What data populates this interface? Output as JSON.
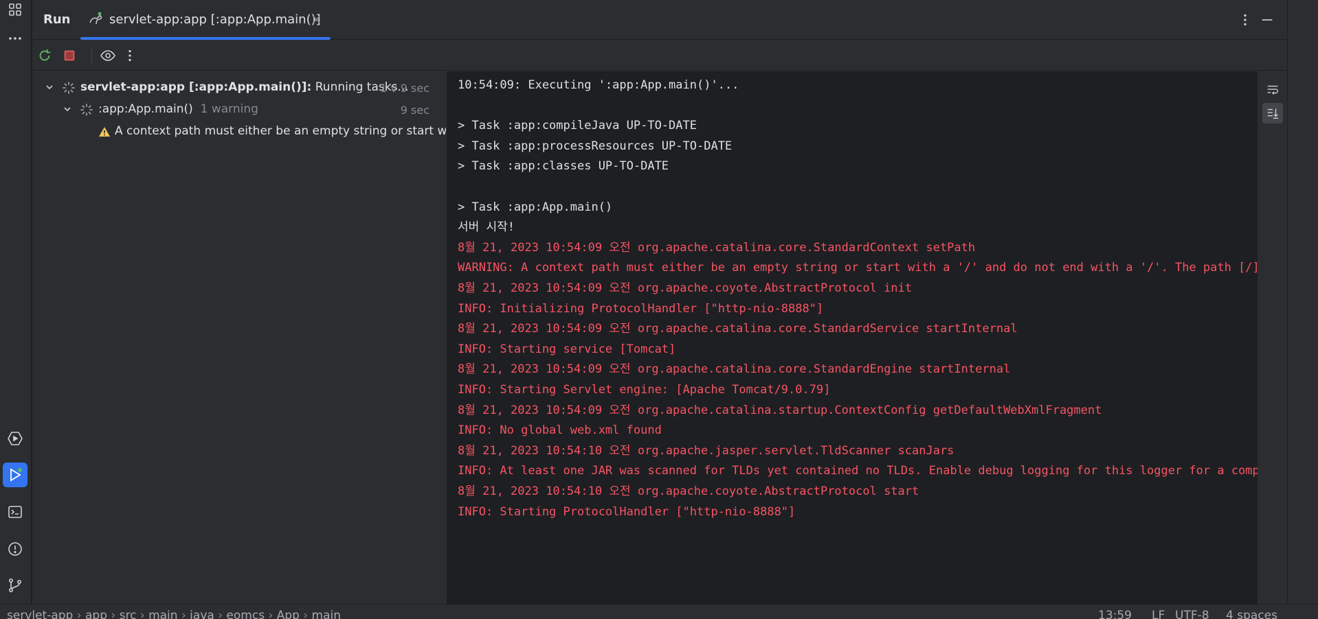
{
  "toolwindow": {
    "title": "Run",
    "tab_title": "servlet-app:app [:app:App.main()]",
    "close_glyph": "×"
  },
  "tree": {
    "root": {
      "label_bold": "servlet-app:app [:app:App.main()]:",
      "label_status": " Running tasks...",
      "time": "1 v 9 sec"
    },
    "child": {
      "label": ":app:App.main()",
      "badge": "1 warning",
      "time": "9 sec"
    },
    "warning": {
      "text": "A context path must either be an empty string or start with a '/' and do not end with a '/'."
    }
  },
  "console": {
    "lines": [
      {
        "text": "10:54:09: Executing ':app:App.main()'...",
        "type": "normal"
      },
      {
        "text": "",
        "type": "normal"
      },
      {
        "text": "> Task :app:compileJava UP-TO-DATE",
        "type": "normal"
      },
      {
        "text": "> Task :app:processResources UP-TO-DATE",
        "type": "normal"
      },
      {
        "text": "> Task :app:classes UP-TO-DATE",
        "type": "normal"
      },
      {
        "text": "",
        "type": "normal"
      },
      {
        "text": "> Task :app:App.main()",
        "type": "normal"
      },
      {
        "text": "서버 시작!",
        "type": "normal"
      },
      {
        "text": "8월 21, 2023 10:54:09 오전 org.apache.catalina.core.StandardContext setPath",
        "type": "err"
      },
      {
        "text": "WARNING: A context path must either be an empty string or start with a '/' and do not end with a '/'. The path [/] does not meet these criteria and has been changed to []",
        "type": "err"
      },
      {
        "text": "8월 21, 2023 10:54:09 오전 org.apache.coyote.AbstractProtocol init",
        "type": "err"
      },
      {
        "text": "INFO: Initializing ProtocolHandler [\"http-nio-8888\"]",
        "type": "err"
      },
      {
        "text": "8월 21, 2023 10:54:09 오전 org.apache.catalina.core.StandardService startInternal",
        "type": "err"
      },
      {
        "text": "INFO: Starting service [Tomcat]",
        "type": "err"
      },
      {
        "text": "8월 21, 2023 10:54:09 오전 org.apache.catalina.core.StandardEngine startInternal",
        "type": "err"
      },
      {
        "text": "INFO: Starting Servlet engine: [Apache Tomcat/9.0.79]",
        "type": "err"
      },
      {
        "text": "8월 21, 2023 10:54:09 오전 org.apache.catalina.startup.ContextConfig getDefaultWebXmlFragment",
        "type": "err"
      },
      {
        "text": "INFO: No global web.xml found",
        "type": "err"
      },
      {
        "text": "8월 21, 2023 10:54:10 오전 org.apache.jasper.servlet.TldScanner scanJars",
        "type": "err"
      },
      {
        "text": "INFO: At least one JAR was scanned for TLDs yet contained no TLDs. Enable debug logging for this logger for a complete list of JARs that were scanned but no TLDs were found in them.",
        "type": "err"
      },
      {
        "text": "8월 21, 2023 10:54:10 오전 org.apache.coyote.AbstractProtocol start",
        "type": "err"
      },
      {
        "text": "INFO: Starting ProtocolHandler [\"http-nio-8888\"]",
        "type": "err"
      }
    ]
  },
  "statusbar": {
    "crumbs": [
      "servlet-app",
      "app",
      "src",
      "main",
      "java",
      "eomcs",
      "App",
      "main"
    ],
    "separator": "›",
    "position": "13:59",
    "line_sep": "LF",
    "encoding": "UTF-8",
    "indent": "4 spaces"
  },
  "colors": {
    "accent": "#3574f0",
    "error_text": "#f75464",
    "warning": "#f2c55c",
    "stop_red": "#db5c5c",
    "rerun_green": "#5fb865"
  },
  "icons": {
    "left": [
      "structure-icon",
      "more-icon",
      "services-icon",
      "run-icon",
      "terminal-icon",
      "problems-icon",
      "git-icon"
    ],
    "toolbar": [
      "rerun-icon",
      "stop-icon",
      "eye-icon",
      "more-vertical-icon"
    ],
    "console_side": [
      "soft-wrap-icon",
      "scroll-to-end-icon"
    ]
  }
}
